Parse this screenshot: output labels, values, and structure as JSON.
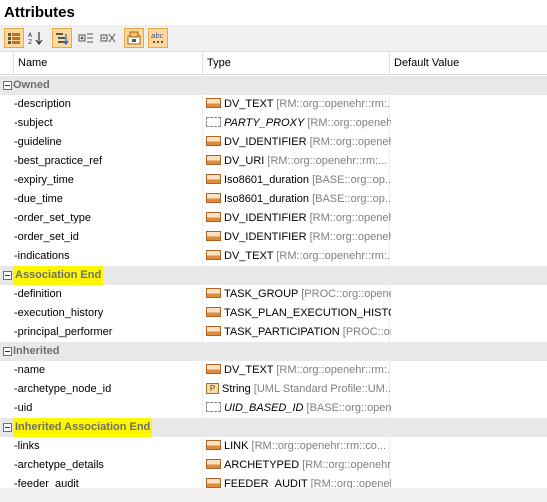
{
  "panel": {
    "title": "Attributes"
  },
  "toolbar": {
    "buttons": [
      {
        "name": "categorized-icon",
        "active": true
      },
      {
        "name": "alphabetical-sort-icon",
        "active": false
      },
      {
        "name": "group-by-icon",
        "active": true
      },
      {
        "name": "expand-all-icon",
        "active": false
      },
      {
        "name": "collapse-all-icon",
        "active": false
      },
      {
        "name": "show-inherited-icon",
        "active": true
      },
      {
        "name": "show-more-icon",
        "active": true,
        "text": "abc"
      }
    ]
  },
  "columns": {
    "name": "Name",
    "type": "Type",
    "default": "Default Value"
  },
  "groups": [
    {
      "label": "Owned",
      "highlight": false,
      "rows": [
        {
          "name": "-description",
          "icon": "class",
          "type": "DV_TEXT",
          "path": " [RM::org::openehr::rm:..."
        },
        {
          "name": "-subject",
          "icon": "dashed",
          "type": "PARTY_PROXY",
          "italic": true,
          "path": " [RM::org::openehr::rm:..."
        },
        {
          "name": "-guideline",
          "icon": "class",
          "type": "DV_IDENTIFIER",
          "path": " [RM::org::openehr::rm:..."
        },
        {
          "name": "-best_practice_ref",
          "icon": "class",
          "type": "DV_URI",
          "path": " [RM::org::openehr::rm:..."
        },
        {
          "name": "-expiry_time",
          "icon": "class",
          "type": "Iso8601_duration",
          "path": " [BASE::org::op..."
        },
        {
          "name": "-due_time",
          "icon": "class",
          "type": "Iso8601_duration",
          "path": " [BASE::org::op..."
        },
        {
          "name": "-order_set_type",
          "icon": "class",
          "type": "DV_IDENTIFIER",
          "path": " [RM::org::openehr::rm::..."
        },
        {
          "name": "-order_set_id",
          "icon": "class",
          "type": "DV_IDENTIFIER",
          "path": " [RM::org::openehr::rm::..."
        },
        {
          "name": "-indications",
          "icon": "class",
          "type": "DV_TEXT",
          "path": " [RM::org::openehr::rm:..."
        }
      ]
    },
    {
      "label": "Association End",
      "highlight": true,
      "rows": [
        {
          "name": "-definition",
          "icon": "class",
          "type": "TASK_GROUP",
          "path": " [PROC::org::openehr::..."
        },
        {
          "name": "-execution_history",
          "icon": "class",
          "type": "TASK_PLAN_EXECUTION_HISTO...",
          "path": ""
        },
        {
          "name": "-principal_performer",
          "icon": "class",
          "type": "TASK_PARTICIPATION",
          "path": " [PROC::or..."
        }
      ]
    },
    {
      "label": "Inherited",
      "highlight": false,
      "rows": [
        {
          "name": "-name",
          "icon": "class",
          "type": "DV_TEXT",
          "path": " [RM::org::openehr::rm:..."
        },
        {
          "name": "-archetype_node_id",
          "icon": "prim",
          "type": "String",
          "path": " [UML Standard Profile::UM..."
        },
        {
          "name": "-uid",
          "icon": "dashed",
          "type": "UID_BASED_ID",
          "italic": true,
          "path": " [BASE::org::open..."
        }
      ]
    },
    {
      "label": "Inherited Association End",
      "highlight": true,
      "rows": [
        {
          "name": "-links",
          "icon": "class",
          "type": "LINK",
          "path": " [RM::org::openehr::rm::co..."
        },
        {
          "name": "-archetype_details",
          "icon": "class",
          "type": "ARCHETYPED",
          "path": " [RM::org::openehr:..."
        },
        {
          "name": "-feeder_audit",
          "icon": "class",
          "type": "FEEDER_AUDIT",
          "path": " [RM::org::openehr..."
        }
      ]
    }
  ]
}
